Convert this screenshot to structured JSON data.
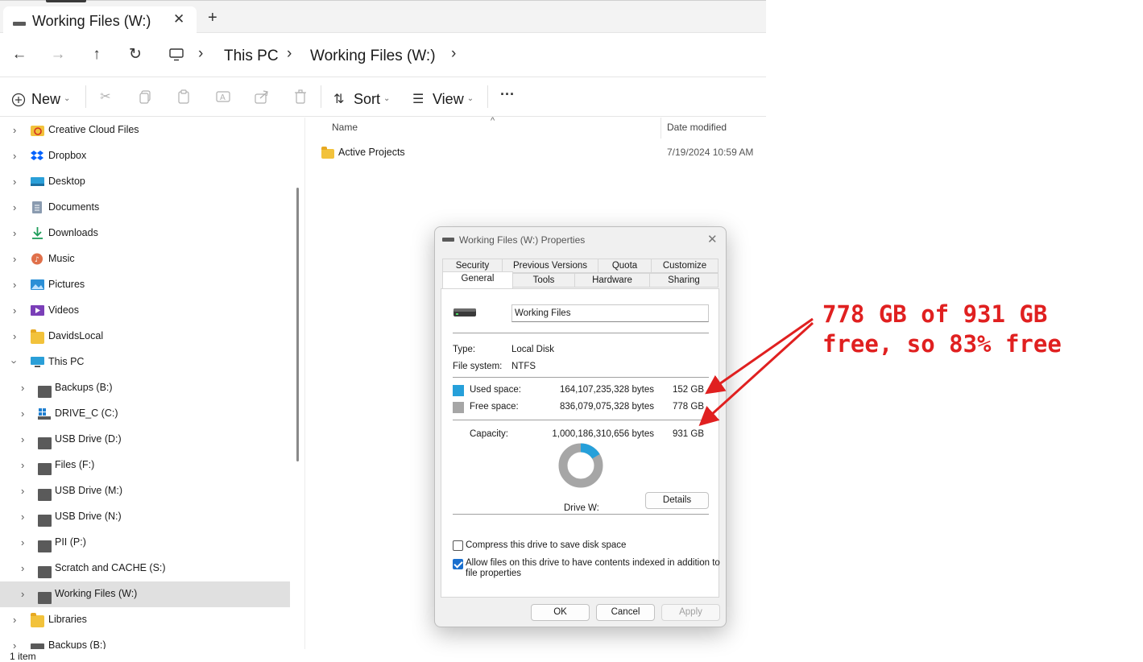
{
  "window": {
    "tab_title": "Working Files (W:)",
    "tab_close": "✕",
    "new_tab": "+"
  },
  "nav": {
    "back": "←",
    "forward": "→",
    "up": "↑",
    "refresh": "↻",
    "breadcrumbs": [
      "This PC",
      "Working Files (W:)"
    ],
    "separator": "›"
  },
  "toolbar": {
    "new_label": "New",
    "sort_label": "Sort",
    "view_label": "View",
    "more_label": "···"
  },
  "sidebar": {
    "items": [
      {
        "label": "Creative Cloud Files",
        "icon": "creative-cloud-icon"
      },
      {
        "label": "Dropbox",
        "icon": "dropbox-icon"
      },
      {
        "label": "Desktop",
        "icon": "desktop-icon"
      },
      {
        "label": "Documents",
        "icon": "documents-icon"
      },
      {
        "label": "Downloads",
        "icon": "downloads-icon"
      },
      {
        "label": "Music",
        "icon": "music-icon"
      },
      {
        "label": "Pictures",
        "icon": "pictures-icon"
      },
      {
        "label": "Videos",
        "icon": "videos-icon"
      },
      {
        "label": "DavidsLocal",
        "icon": "folder-icon"
      },
      {
        "label": "This PC",
        "icon": "pc-icon"
      },
      {
        "label": "Backups (B:)",
        "icon": "drive-icon"
      },
      {
        "label": "DRIVE_C (C:)",
        "icon": "windows-drive-icon"
      },
      {
        "label": "USB Drive (D:)",
        "icon": "drive-icon"
      },
      {
        "label": "Files (F:)",
        "icon": "drive-icon"
      },
      {
        "label": "USB Drive (M:)",
        "icon": "drive-icon"
      },
      {
        "label": "USB Drive (N:)",
        "icon": "drive-icon"
      },
      {
        "label": "PII (P:)",
        "icon": "drive-icon"
      },
      {
        "label": "Scratch and CACHE (S:)",
        "icon": "drive-icon"
      },
      {
        "label": "Working Files (W:)",
        "icon": "drive-icon"
      },
      {
        "label": "Libraries",
        "icon": "libraries-icon"
      },
      {
        "label": "Backups (B:)",
        "icon": "drive-icon"
      }
    ]
  },
  "filelist": {
    "col_name": "Name",
    "col_date": "Date modified",
    "rows": [
      {
        "name": "Active Projects",
        "date": "7/19/2024 10:59 AM"
      }
    ]
  },
  "status": {
    "item_count": "1 item"
  },
  "dialog": {
    "title": "Working Files (W:) Properties",
    "close": "✕",
    "tabs_row1": [
      "Security",
      "Previous Versions",
      "Quota",
      "Customize"
    ],
    "tabs_row2": [
      "General",
      "Tools",
      "Hardware",
      "Sharing"
    ],
    "drive_name": "Working Files",
    "type_label": "Type:",
    "type_value": "Local Disk",
    "fs_label": "File system:",
    "fs_value": "NTFS",
    "used_label": "Used space:",
    "used_bytes": "164,107,235,328 bytes",
    "used_gb": "152 GB",
    "free_label": "Free space:",
    "free_bytes": "836,079,075,328 bytes",
    "free_gb": "778 GB",
    "capacity_label": "Capacity:",
    "capacity_bytes": "1,000,186,310,656 bytes",
    "capacity_gb": "931 GB",
    "drive_letter_label": "Drive W:",
    "details_btn": "Details",
    "compress_label": "Compress this drive to save disk space",
    "compress_checked": false,
    "index_label_1": "Allow files on this drive to have contents indexed in addition to",
    "index_label_2": "file properties",
    "index_checked": true,
    "ok_btn": "OK",
    "cancel_btn": "Cancel",
    "apply_btn": "Apply",
    "used_color": "#26a0da",
    "free_color": "#a6a6a6",
    "used_fraction": 0.1641
  },
  "annotation": {
    "text": "778 GB of 931 GB\nfree, so 83% free",
    "color": "#e02020"
  }
}
